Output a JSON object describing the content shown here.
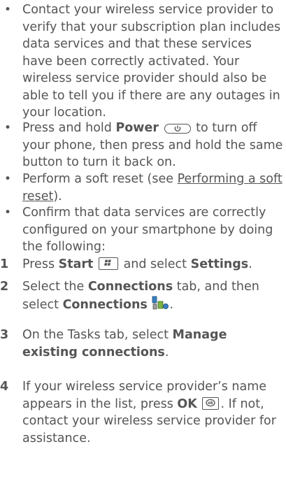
{
  "bullets": [
    {
      "text": "Contact your wireless service provider to verify that your subscription plan includes data services and that these services have been correctly activated. Your wireless service provider should also be able to tell you if there are any outages in your location."
    },
    {
      "prefix": "Press and hold ",
      "bold": "Power",
      "suffix": " to turn off your phone, then press and hold the same button to turn it back on."
    },
    {
      "prefix": "Perform a soft reset (see ",
      "link": "Performing a soft reset",
      "suffix": ")."
    },
    {
      "text": "Confirm that data services are correctly configured on your smartphone by doing the following:"
    }
  ],
  "steps": [
    {
      "num": "1",
      "p1": "Press ",
      "b1": "Start",
      "p2": " and select ",
      "b2": "Settings",
      "p3": "."
    },
    {
      "num": "2",
      "p1": "Select the ",
      "b1": "Connections",
      "p2": " tab, and then select ",
      "b2": "Connections",
      "p3": "."
    },
    {
      "num": "3",
      "p1": "On the Tasks tab, select ",
      "b1": "Manage existing connections",
      "p2": "."
    },
    {
      "num": "4",
      "p1": "If your wireless service provider’s name appears in the list, press ",
      "b1": "OK",
      "p2": ". If not, contact your wireless service provider for assistance."
    }
  ],
  "icons": {
    "power_key": "power-button-icon",
    "start_key": "windows-start-key-icon",
    "connections": "connections-icon",
    "ok_key": "ok-key-icon"
  }
}
